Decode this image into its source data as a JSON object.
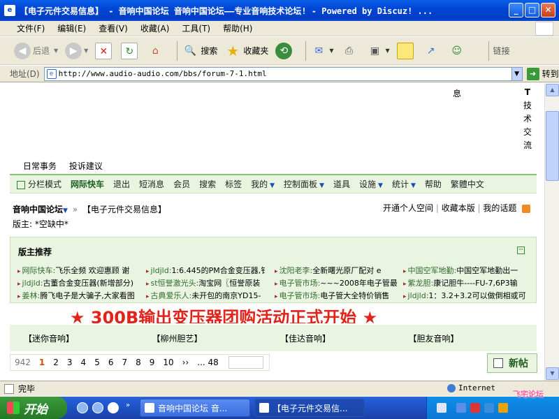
{
  "window": {
    "title": "【电子元件交易信息】 - 音响中国论坛 音响中国论坛——专业音响技术论坛! - Powered by Discuz! ...",
    "min": "_",
    "max": "□",
    "close": "✕"
  },
  "menu": [
    "文件(F)",
    "编辑(E)",
    "查看(V)",
    "收藏(A)",
    "工具(T)",
    "帮助(H)"
  ],
  "toolbar": {
    "back": "后退",
    "search": "搜索",
    "favorites": "收藏夹",
    "links": "链接"
  },
  "address": {
    "label": "地址(D)",
    "url": "http://www.audio-audio.com/bbs/forum-7-1.html",
    "go": "转到"
  },
  "page": {
    "xi": "息",
    "vertical": [
      "T",
      "技",
      "术",
      "交",
      "流"
    ],
    "toplinks": [
      "日常事务",
      "投诉建议"
    ],
    "nav": [
      {
        "label": "分栏模式"
      },
      {
        "label": "网际快车",
        "bold": true
      },
      {
        "label": "退出"
      },
      {
        "label": "短消息"
      },
      {
        "label": "会员"
      },
      {
        "label": "搜索"
      },
      {
        "label": "标签"
      },
      {
        "label": "我的",
        "dd": true
      },
      {
        "label": "控制面板",
        "dd": true
      },
      {
        "label": "道具"
      },
      {
        "label": "设施",
        "dd": true
      },
      {
        "label": "统计",
        "dd": true
      },
      {
        "label": "帮助"
      },
      {
        "label": "繁體中文"
      }
    ],
    "breadcrumb": {
      "home": "音响中国论坛",
      "sep": "»",
      "current": "【电子元件交易信息】"
    },
    "crumb_links": [
      "开通个人空间",
      "收藏本版",
      "我的话题"
    ],
    "moderator": "版主: *空缺中*",
    "recommend": {
      "title": "版主推荐",
      "rows": [
        [
          {
            "author": "网际快车:",
            "text": "飞乐全频 欢迎惠顾 谢"
          },
          {
            "author": "jldjld:",
            "text": "1:6.445的PM合金变压器,钅"
          },
          {
            "author": "沈阳老李:",
            "text": "全新曙光原厂配对 e"
          },
          {
            "author": "中国空军地勤:",
            "text": "中国空军地勤出一"
          }
        ],
        [
          {
            "author": "jldjld:",
            "text": "古董合金变压器(新增部分)"
          },
          {
            "author": "st恒誉激光头:",
            "text": "淘宝网〖恒誉原装"
          },
          {
            "author": "电子管市场:",
            "text": "~~~2008年电子管最"
          },
          {
            "author": "紫龙胆:",
            "text": "康记胆牛----FU-7,6P3输"
          }
        ],
        [
          {
            "author": "姜林:",
            "text": "腾飞电子是大骗子,大家看图"
          },
          {
            "author": "古典爱乐人:",
            "text": "未开包的南京YD15-"
          },
          {
            "author": "电子管市场:",
            "text": "电子管大全特价销售"
          },
          {
            "author": "jldjld:",
            "text": "1：3.2+3.2可以做倒相或可"
          }
        ]
      ]
    },
    "banner": "★ 300B输出变压器团购活动正式开始 ★",
    "categories": [
      "【迷你音响】",
      "【柳州胆艺】",
      "【佳达音响】",
      "【胆友音响】"
    ],
    "pager": {
      "total": "942",
      "pages": [
        "1",
        "2",
        "3",
        "4",
        "5",
        "6",
        "7",
        "8",
        "9",
        "10",
        "››",
        "... 48"
      ],
      "current": "1"
    },
    "newpost": "新帖"
  },
  "status": {
    "text": "完毕",
    "zone": "Internet"
  },
  "taskbar": {
    "start": "开始",
    "tasks": [
      "音响中国论坛 音...",
      "【电子元件交易信..."
    ],
    "watermark": "飞宅论坛"
  }
}
